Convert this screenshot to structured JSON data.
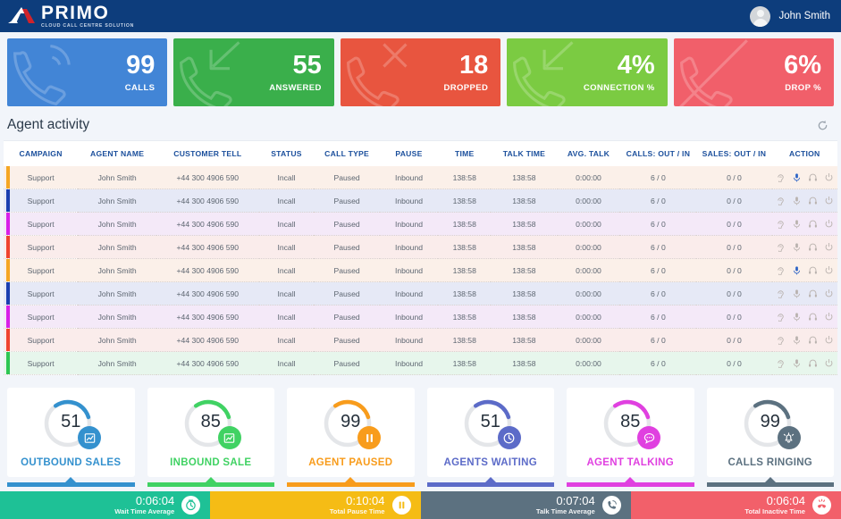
{
  "header": {
    "logo_name": "PRIMO",
    "logo_tagline": "CLOUD CALL CENTRE SOLUTION",
    "user_name": "John Smith",
    "bg_color": "#0d3d7c"
  },
  "kpis": [
    {
      "value": "99",
      "label": "CALLS",
      "color": "#4285d6",
      "icon": "phone-waves-icon"
    },
    {
      "value": "55",
      "label": "ANSWERED",
      "color": "#3aaf4b",
      "icon": "phone-incoming-icon"
    },
    {
      "value": "18",
      "label": "DROPPED",
      "color": "#e8553f",
      "icon": "phone-cancel-icon"
    },
    {
      "value": "4%",
      "label": "CONNECTION %",
      "color": "#7bcb42",
      "icon": "phone-incoming-icon"
    },
    {
      "value": "6%",
      "label": "DROP %",
      "color": "#f15f6a",
      "icon": "phone-slash-icon"
    }
  ],
  "agent_activity": {
    "title": "Agent activity",
    "refresh_icon": "refresh-icon",
    "columns": [
      "CAMPAIGN",
      "AGENT NAME",
      "CUSTOMER TELL",
      "STATUS",
      "CALL TYPE",
      "PAUSE",
      "TIME",
      "TALK TIME",
      "AVG. TALK",
      "CALLS: OUT / IN",
      "SALES: OUT / IN",
      "ACTION"
    ],
    "action_icons": [
      "ear-listen-icon",
      "microphone-icon",
      "headset-icon",
      "power-icon"
    ],
    "rows": [
      {
        "campaign": "Support",
        "agent": "John Smith",
        "tell": "+44 300 4906 590",
        "status": "Incall",
        "call_type": "Paused",
        "pause": "Inbound",
        "time": "138:58",
        "talk_time": "138:58",
        "avg_talk": "0:00:00",
        "calls": "6 / 0",
        "sales": "0 / 0",
        "accent": "#f5a623",
        "bg": "#fbf0e9",
        "mic_active": true
      },
      {
        "campaign": "Support",
        "agent": "John Smith",
        "tell": "+44 300 4906 590",
        "status": "Incall",
        "call_type": "Paused",
        "pause": "Inbound",
        "time": "138:58",
        "talk_time": "138:58",
        "avg_talk": "0:00:00",
        "calls": "6 / 0",
        "sales": "0 / 0",
        "accent": "#1b3fb0",
        "bg": "#e6e9f6",
        "mic_active": false
      },
      {
        "campaign": "Support",
        "agent": "John Smith",
        "tell": "+44 300 4906 590",
        "status": "Incall",
        "call_type": "Paused",
        "pause": "Inbound",
        "time": "138:58",
        "talk_time": "138:58",
        "avg_talk": "0:00:00",
        "calls": "6 / 0",
        "sales": "0 / 0",
        "accent": "#d821e8",
        "bg": "#f4e9f8",
        "mic_active": false
      },
      {
        "campaign": "Support",
        "agent": "John Smith",
        "tell": "+44 300 4906 590",
        "status": "Incall",
        "call_type": "Paused",
        "pause": "Inbound",
        "time": "138:58",
        "talk_time": "138:58",
        "avg_talk": "0:00:00",
        "calls": "6 / 0",
        "sales": "0 / 0",
        "accent": "#ef4430",
        "bg": "#faeceb",
        "mic_active": false
      },
      {
        "campaign": "Support",
        "agent": "John Smith",
        "tell": "+44 300 4906 590",
        "status": "Incall",
        "call_type": "Paused",
        "pause": "Inbound",
        "time": "138:58",
        "talk_time": "138:58",
        "avg_talk": "0:00:00",
        "calls": "6 / 0",
        "sales": "0 / 0",
        "accent": "#f5a623",
        "bg": "#fbf0e9",
        "mic_active": true
      },
      {
        "campaign": "Support",
        "agent": "John Smith",
        "tell": "+44 300 4906 590",
        "status": "Incall",
        "call_type": "Paused",
        "pause": "Inbound",
        "time": "138:58",
        "talk_time": "138:58",
        "avg_talk": "0:00:00",
        "calls": "6 / 0",
        "sales": "0 / 0",
        "accent": "#1b3fb0",
        "bg": "#e6e9f6",
        "mic_active": false
      },
      {
        "campaign": "Support",
        "agent": "John Smith",
        "tell": "+44 300 4906 590",
        "status": "Incall",
        "call_type": "Paused",
        "pause": "Inbound",
        "time": "138:58",
        "talk_time": "138:58",
        "avg_talk": "0:00:00",
        "calls": "6 / 0",
        "sales": "0 / 0",
        "accent": "#d821e8",
        "bg": "#f4e9f8",
        "mic_active": false
      },
      {
        "campaign": "Support",
        "agent": "John Smith",
        "tell": "+44 300 4906 590",
        "status": "Incall",
        "call_type": "Paused",
        "pause": "Inbound",
        "time": "138:58",
        "talk_time": "138:58",
        "avg_talk": "0:00:00",
        "calls": "6 / 0",
        "sales": "0 / 0",
        "accent": "#ef4430",
        "bg": "#faeceb",
        "mic_active": false
      },
      {
        "campaign": "Support",
        "agent": "John Smith",
        "tell": "+44 300 4906 590",
        "status": "Incall",
        "call_type": "Paused",
        "pause": "Inbound",
        "time": "138:58",
        "talk_time": "138:58",
        "avg_talk": "0:00:00",
        "calls": "6 / 0",
        "sales": "0 / 0",
        "accent": "#2dc653",
        "bg": "#e7f6ec",
        "mic_active": false
      }
    ]
  },
  "gauges": [
    {
      "value": "51",
      "label": "OUTBOUND SALES",
      "color": "#3491ce",
      "icon": "chart-up-icon",
      "arc_pct": 30
    },
    {
      "value": "85",
      "label": "INBOUND SALE",
      "color": "#40d263",
      "icon": "chart-up-icon",
      "arc_pct": 30
    },
    {
      "value": "99",
      "label": "AGENT PAUSED",
      "color": "#f89c1c",
      "icon": "pause-icon",
      "arc_pct": 30
    },
    {
      "value": "51",
      "label": "AGENTS WAITING",
      "color": "#5c6bc8",
      "icon": "clock-icon",
      "arc_pct": 30
    },
    {
      "value": "85",
      "label": "AGENT TALKING",
      "color": "#e040e0",
      "icon": "chat-icon",
      "arc_pct": 30
    },
    {
      "value": "99",
      "label": "CALLS RINGING",
      "color": "#5c7180",
      "icon": "bell-ring-icon",
      "arc_pct": 30
    }
  ],
  "status_bar": [
    {
      "time": "0:06:04",
      "label": "Wait Time Average",
      "color": "#1ec196",
      "icon": "wait-clock-icon",
      "icon_color": "#1ec196"
    },
    {
      "time": "0:10:04",
      "label": "Total Pause Time",
      "color": "#f5bc15",
      "icon": "pause-icon",
      "icon_color": "#f5bc15"
    },
    {
      "time": "0:07:04",
      "label": "Talk Time Average",
      "color": "#5c7180",
      "icon": "phone-talk-icon",
      "icon_color": "#5c7180"
    },
    {
      "time": "0:06:04",
      "label": "Total Inactive Time",
      "color": "#f2606a",
      "icon": "phone-ringing-icon",
      "icon_color": "#f2606a"
    }
  ]
}
